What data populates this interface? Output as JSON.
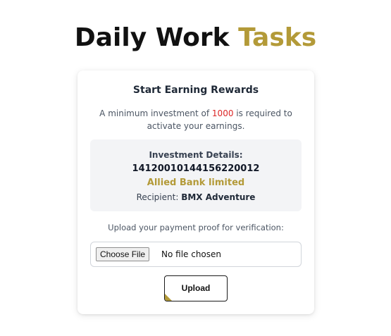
{
  "header": {
    "title_main": "Daily Work ",
    "title_accent": "Tasks"
  },
  "card": {
    "title": "Start Earning Rewards",
    "desc_prefix": "A minimum investment of ",
    "desc_amount": "1000",
    "desc_suffix": " is required to activate your earnings.",
    "details": {
      "heading": "Investment Details:",
      "account_number": "14120010144156220012",
      "bank_name": "Allied Bank limited",
      "recipient_label": "Recipient: ",
      "recipient_name": "BMX Adventure"
    },
    "upload_note": "Upload your payment proof for verification:",
    "file_input": {
      "button_label": "Choose File",
      "status": "No file chosen"
    },
    "upload_button_label": "Upload"
  },
  "colors": {
    "accent": "#b39a38",
    "amount": "#dc2626"
  }
}
